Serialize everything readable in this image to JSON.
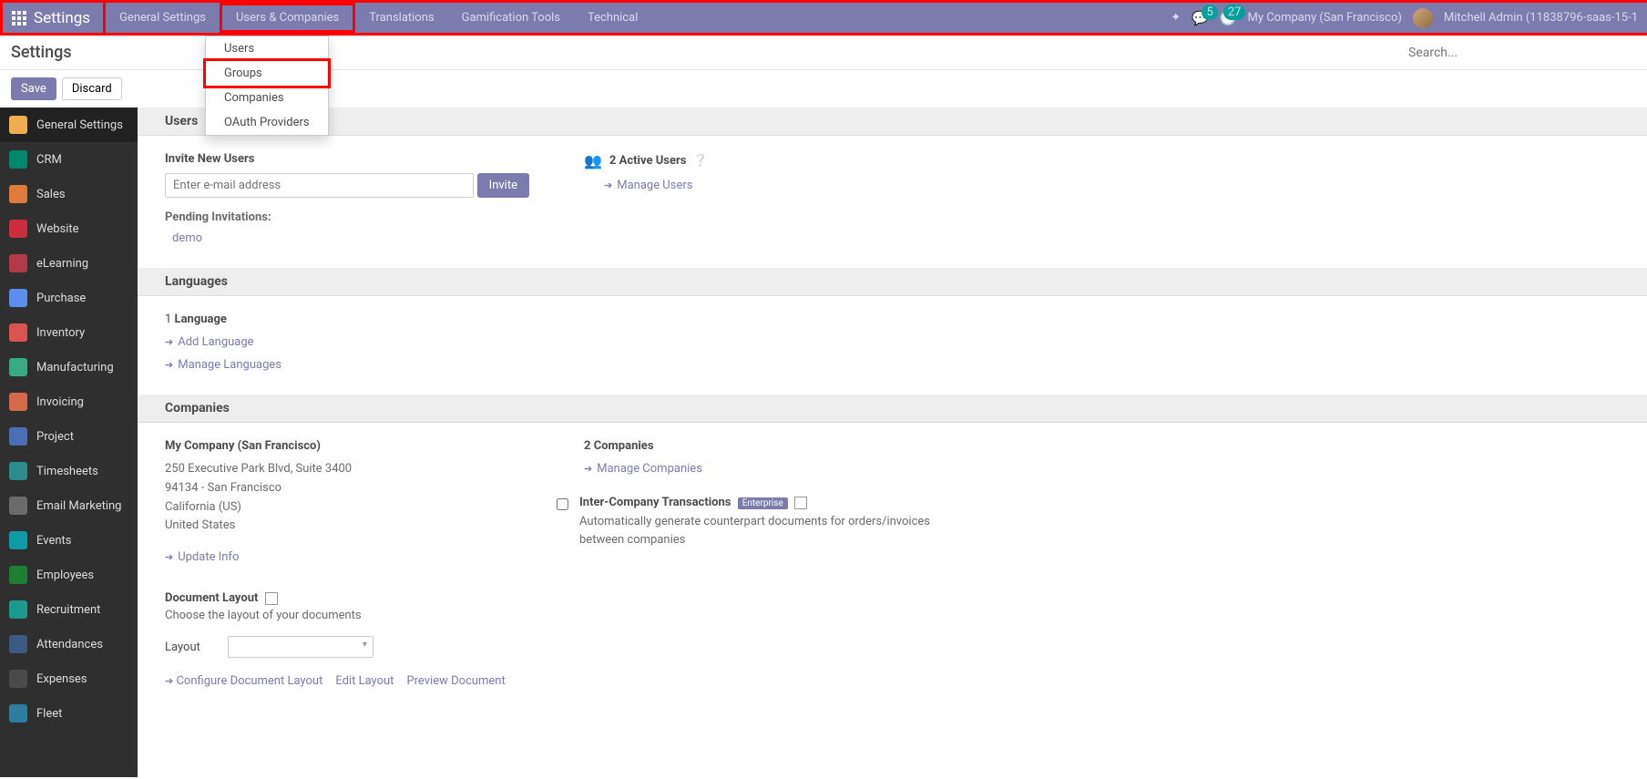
{
  "header": {
    "app_title": "Settings",
    "menu": [
      "General Settings",
      "Users & Companies",
      "Translations",
      "Gamification Tools",
      "Technical"
    ],
    "company": "My Company (San Francisco)",
    "user": "Mitchell Admin (11838796-saas-15-1",
    "msg_badge": "5",
    "activity_badge": "27"
  },
  "dropdown": {
    "items": [
      "Users",
      "Groups",
      "Companies",
      "OAuth Providers"
    ]
  },
  "subheader": {
    "title": "Settings",
    "search_placeholder": "Search..."
  },
  "toolbar": {
    "save": "Save",
    "discard": "Discard"
  },
  "sidebar": [
    {
      "label": "General Settings",
      "color": "#f0ad4e"
    },
    {
      "label": "CRM",
      "color": "#00876c"
    },
    {
      "label": "Sales",
      "color": "#e07b39"
    },
    {
      "label": "Website",
      "color": "#CB2D3E"
    },
    {
      "label": "eLearning",
      "color": "#b23a48"
    },
    {
      "label": "Purchase",
      "color": "#5b8def"
    },
    {
      "label": "Inventory",
      "color": "#d9534f"
    },
    {
      "label": "Manufacturing",
      "color": "#3aaa85"
    },
    {
      "label": "Invoicing",
      "color": "#d6694a"
    },
    {
      "label": "Project",
      "color": "#4a6fb5"
    },
    {
      "label": "Timesheets",
      "color": "#2b8c8c"
    },
    {
      "label": "Email Marketing",
      "color": "#6b6b6b"
    },
    {
      "label": "Events",
      "color": "#0e9aa7"
    },
    {
      "label": "Employees",
      "color": "#1e7e34"
    },
    {
      "label": "Recruitment",
      "color": "#1b998b"
    },
    {
      "label": "Attendances",
      "color": "#3d5a80"
    },
    {
      "label": "Expenses",
      "color": "#4a4a4a"
    },
    {
      "label": "Fleet",
      "color": "#2c7da0"
    }
  ],
  "sections": {
    "users": {
      "title": "Users",
      "invite_label": "Invite New Users",
      "email_placeholder": "Enter e-mail address",
      "invite_btn": "Invite",
      "pending_label": "Pending Invitations:",
      "pending_item": "demo",
      "active_count": "2",
      "active_label": "Active Users",
      "manage": "Manage Users"
    },
    "languages": {
      "title": "Languages",
      "count": "1",
      "count_label": "Language",
      "add": "Add Language",
      "manage": "Manage Languages"
    },
    "companies": {
      "title": "Companies",
      "name": "My Company (San Francisco)",
      "addr1": "250 Executive Park Blvd, Suite 3400",
      "addr2": "94134 - San Francisco",
      "addr3": "California (US)",
      "addr4": "United States",
      "update": "Update Info",
      "count": "2",
      "count_label": "Companies",
      "manage": "Manage Companies",
      "inter_label": "Inter-Company Transactions",
      "enterprise": "Enterprise",
      "inter_desc": "Automatically generate counterpart documents for orders/invoices between companies",
      "doc_label": "Document Layout",
      "doc_desc": "Choose the layout of your documents",
      "layout_label": "Layout",
      "configure": "Configure Document Layout",
      "edit": "Edit Layout",
      "preview": "Preview Document"
    }
  }
}
